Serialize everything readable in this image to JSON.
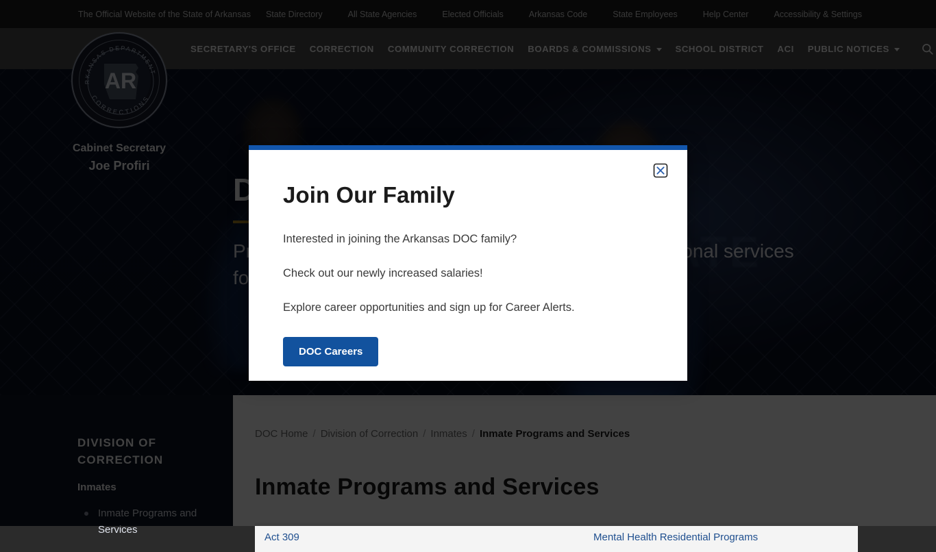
{
  "topbar": {
    "official": "The Official Website of the State of Arkansas",
    "links": [
      "State Directory",
      "All State Agencies",
      "Elected Officials",
      "Arkansas Code",
      "State Employees",
      "Help Center",
      "Accessibility & Settings"
    ]
  },
  "nav": {
    "items": [
      {
        "label": "SECRETARY'S OFFICE",
        "caret": false
      },
      {
        "label": "CORRECTION",
        "caret": false
      },
      {
        "label": "COMMUNITY CORRECTION",
        "caret": false
      },
      {
        "label": "BOARDS & COMMISSIONS",
        "caret": true
      },
      {
        "label": "SCHOOL DISTRICT",
        "caret": false
      },
      {
        "label": "ACI",
        "caret": false
      },
      {
        "label": "PUBLIC NOTICES",
        "caret": true
      }
    ],
    "search_icon": "search-icon"
  },
  "brand": {
    "seal_outer_top": "ARKANSAS DEPARTMENT OF",
    "seal_outer_bottom": "CORRECTIONS",
    "seal_monogram": "AR",
    "secretary_label": "Cabinet Secretary",
    "secretary_name": "Joe Profiri"
  },
  "hero": {
    "title": "DIVISION OF CORRECTION",
    "subtitle": "Provide public safety through custody and rehabilitational services for Arkansas inmates.",
    "accent_color": "#b08b26",
    "ghost_text": "INMATE"
  },
  "sidebar": {
    "title": "DIVISION OF CORRECTION",
    "section": "Inmates",
    "items": [
      {
        "label": "Inmate Programs and Services"
      }
    ]
  },
  "breadcrumb": {
    "items": [
      {
        "label": "DOC Home",
        "current": false
      },
      {
        "label": "Division of Correction",
        "current": false
      },
      {
        "label": "Inmates",
        "current": false
      },
      {
        "label": "Inmate Programs and Services",
        "current": true
      }
    ],
    "separator": "/"
  },
  "main": {
    "page_title": "Inmate Programs and Services",
    "programs": [
      {
        "left": "Act 309",
        "right": "Mental Health Residential Programs"
      }
    ]
  },
  "modal": {
    "title": "Join Our Family",
    "paragraphs": [
      "Interested in joining the Arkansas DOC family?",
      "Check out our newly increased salaries!",
      "Explore career opportunities and sign up for Career Alerts."
    ],
    "cta_label": "DOC Careers",
    "close_icon": "close-boxed-x-icon",
    "accent_color": "#1356ac",
    "cta_color": "#12529e"
  }
}
